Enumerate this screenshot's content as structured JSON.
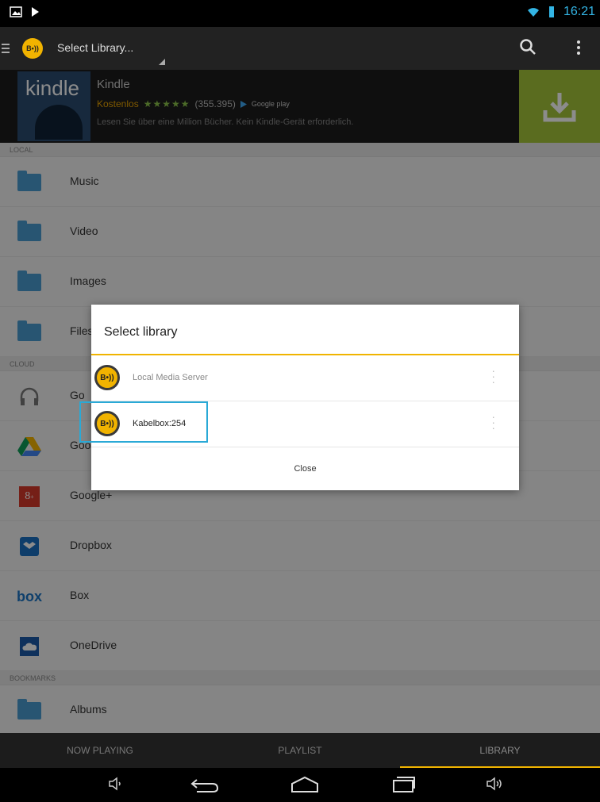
{
  "status": {
    "time": "16:21"
  },
  "actionbar": {
    "title": "Select Library...",
    "logo_text": "B•))"
  },
  "ad": {
    "brand_word": "kindle",
    "name": "Kindle",
    "price": "Kostenlos",
    "stars": "★★★★★",
    "rating": "(355.395)",
    "store": "Google play",
    "description": "Lesen Sie über eine Million Bücher. Kein Kindle-Gerät erforderlich."
  },
  "sections": {
    "local": "LOCAL",
    "cloud": "CLOUD",
    "bookmarks": "BOOKMARKS"
  },
  "local_items": [
    {
      "label": "Music"
    },
    {
      "label": "Video"
    },
    {
      "label": "Images"
    },
    {
      "label": "Files"
    }
  ],
  "cloud_items": [
    {
      "label": "Go"
    },
    {
      "label": "Goo"
    },
    {
      "label": "Google+"
    },
    {
      "label": "Dropbox"
    },
    {
      "label": "Box",
      "icon_text": "box"
    },
    {
      "label": "OneDrive"
    }
  ],
  "bookmark_items": [
    {
      "label": "Albums"
    }
  ],
  "dialog": {
    "title": "Select library",
    "items": [
      {
        "name": "Local Media Server",
        "color": "#888888"
      },
      {
        "name": "Kabelbox:254",
        "color": "#222222"
      }
    ],
    "close_label": "Close"
  },
  "tabs": [
    {
      "label": "NOW PLAYING"
    },
    {
      "label": "PLAYLIST"
    },
    {
      "label": "LIBRARY",
      "active": true
    }
  ],
  "colors": {
    "accent": "#f0b400",
    "highlight": "#2aa9d6"
  }
}
